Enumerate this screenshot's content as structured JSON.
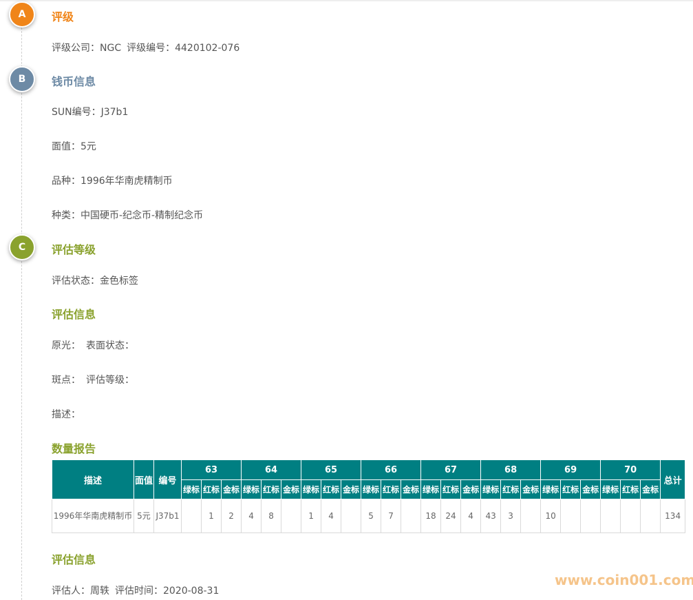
{
  "sections": {
    "a": {
      "badge": "A",
      "title": "评级",
      "color": "#f08519"
    },
    "b": {
      "badge": "B",
      "title": "钱币信息",
      "color": "#6d8aa5"
    },
    "c": {
      "badge": "C",
      "title": "评估等级",
      "color": "#8aa22e"
    }
  },
  "grading": {
    "company_label": "评级公司：",
    "company": "NGC",
    "number_label": "评级编号：",
    "number": "4420102-076"
  },
  "coin": {
    "sun_label": "SUN编号：",
    "sun": "J37b1",
    "face_label": "面值：",
    "face": "5元",
    "variety_label": "品种：",
    "variety": "1996年华南虎精制币",
    "category_label": "种类：",
    "category": "中国硬币-纪念币-精制纪念币"
  },
  "assessment": {
    "status_label": "评估状态：",
    "status": "金色标签",
    "info_title": "评估信息",
    "luster_label": "原光：",
    "surface_label": "表面状态：",
    "spots_label": "斑点：",
    "grade_label": "评估等级：",
    "desc_label": "描述："
  },
  "report": {
    "title": "数量报告",
    "headers": {
      "desc": "描述",
      "face": "面值",
      "code": "编号",
      "total": "总计"
    },
    "grades": [
      "63",
      "64",
      "65",
      "66",
      "67",
      "68",
      "69",
      "70"
    ],
    "sub_labels": [
      "绿标",
      "红标",
      "金标"
    ],
    "row": {
      "desc": "1996年华南虎精制币",
      "face": "5元",
      "code": "J37b1",
      "cells": [
        "",
        "1",
        "2",
        "4",
        "8",
        "",
        "1",
        "4",
        "",
        "5",
        "7",
        "",
        "18",
        "24",
        "4",
        "43",
        "3",
        "",
        "10",
        "",
        "",
        "",
        "",
        ""
      ],
      "total": "134"
    }
  },
  "appraisal": {
    "title": "评估信息",
    "appraiser_label": "评估人：",
    "appraiser": "周轶",
    "time_label": "评估时间：",
    "time": "2020-08-31"
  },
  "watermark": "www.coin001.com"
}
